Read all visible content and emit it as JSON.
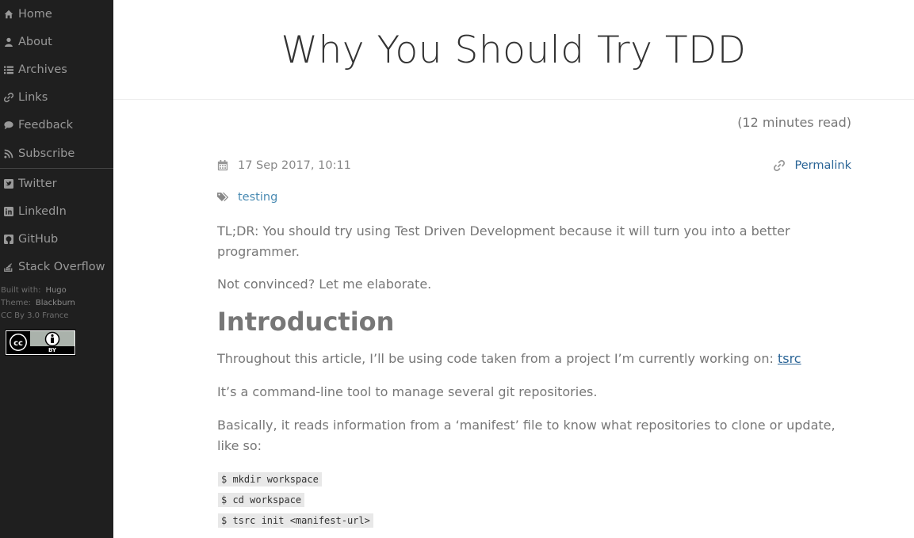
{
  "sidebar": {
    "nav": [
      {
        "label": "Home",
        "icon": "home-icon"
      },
      {
        "label": "About",
        "icon": "user-icon"
      },
      {
        "label": "Archives",
        "icon": "list-icon"
      },
      {
        "label": "Links",
        "icon": "link-icon"
      },
      {
        "label": "Feedback",
        "icon": "comment-icon"
      },
      {
        "label": "Subscribe",
        "icon": "rss-icon"
      }
    ],
    "social": [
      {
        "label": "Twitter",
        "icon": "twitter-icon"
      },
      {
        "label": "LinkedIn",
        "icon": "linkedin-icon"
      },
      {
        "label": "GitHub",
        "icon": "github-icon"
      },
      {
        "label": "Stack Overflow",
        "icon": "stack-overflow-icon"
      }
    ],
    "built_with_label": "Built with:",
    "built_with_value": "Hugo",
    "theme_label": "Theme:",
    "theme_value": "Blackburn",
    "license": "CC By 3.0 France",
    "badge_text": "BY"
  },
  "post": {
    "title": "Why You Should Try TDD",
    "read_time": "(12 minutes read)",
    "date": "17 Sep 2017, 10:11",
    "permalink": "Permalink",
    "tag": "testing",
    "p1": "TL;DR: You should try using Test Driven Development because it will turn you into a better programmer.",
    "p2": "Not convinced? Let me elaborate.",
    "h2": "Introduction",
    "p3_text": "Throughout this article, I’ll be using code taken from a project I’m currently working on: ",
    "p3_link": "tsrc",
    "p4": "It’s a command-line tool to manage several git repositories.",
    "p5": "Basically, it reads information from a ‘manifest’ file to know what repositories to clone or update, like so:",
    "code": [
      "$ mkdir workspace",
      "$ cd workspace",
      "$ tsrc init <manifest-url>"
    ]
  },
  "colors": {
    "sidebar_bg": "#1f1f1f",
    "link": "#2a6496",
    "tag": "#4a8bb3"
  }
}
